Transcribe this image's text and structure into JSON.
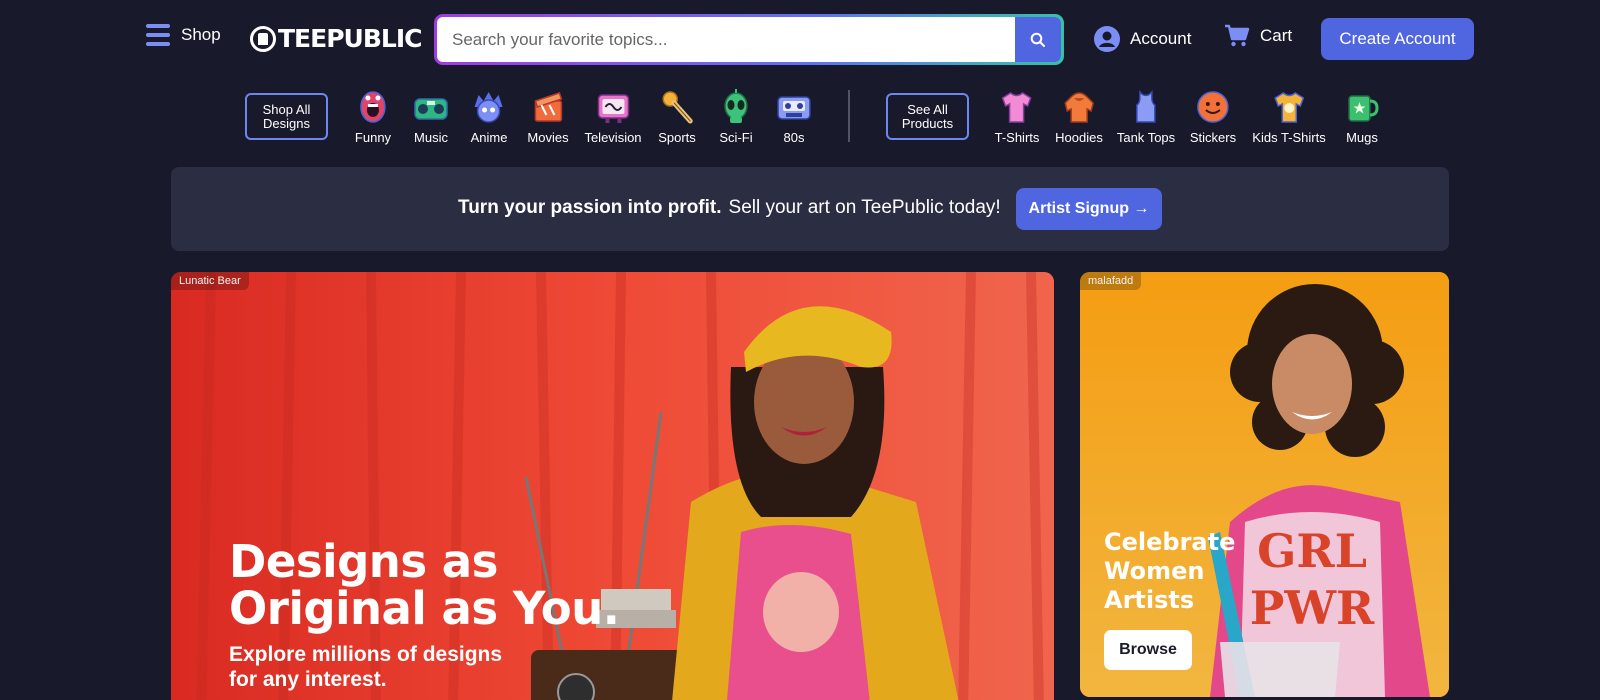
{
  "header": {
    "menu_label": "Shop",
    "logo_text": "TEEPUBLIC",
    "search_placeholder": "Search your favorite topics...",
    "account_label": "Account",
    "cart_label": "Cart",
    "create_account_label": "Create Account"
  },
  "nav": {
    "shop_all_label": "Shop All\nDesigns",
    "see_all_label": "See All\nProducts",
    "design_categories": [
      {
        "label": "Funny",
        "icon": "funny-icon"
      },
      {
        "label": "Music",
        "icon": "music-icon"
      },
      {
        "label": "Anime",
        "icon": "anime-icon"
      },
      {
        "label": "Movies",
        "icon": "movies-icon"
      },
      {
        "label": "Television",
        "icon": "television-icon"
      },
      {
        "label": "Sports",
        "icon": "sports-icon"
      },
      {
        "label": "Sci-Fi",
        "icon": "sci-fi-icon"
      },
      {
        "label": "80s",
        "icon": "80s-icon"
      }
    ],
    "product_categories": [
      {
        "label": "T-Shirts",
        "icon": "t-shirt-icon"
      },
      {
        "label": "Hoodies",
        "icon": "hoodie-icon"
      },
      {
        "label": "Tank Tops",
        "icon": "tank-top-icon"
      },
      {
        "label": "Stickers",
        "icon": "sticker-icon"
      },
      {
        "label": "Kids T-Shirts",
        "icon": "kids-t-shirt-icon"
      },
      {
        "label": "Mugs",
        "icon": "mug-icon"
      }
    ]
  },
  "banner": {
    "bold_text": "Turn your passion into profit.",
    "regular_text": "Sell your art on TeePublic today!",
    "button_label": "Artist Signup →"
  },
  "hero_main": {
    "credit": "Lunatic Bear",
    "title": "Designs as\nOriginal as You.",
    "subtitle": "Explore millions of designs\nfor any interest."
  },
  "hero_side": {
    "credit": "malafadd",
    "title": "Celebrate\nWomen\nArtists",
    "button_label": "Browse"
  },
  "colors": {
    "background": "#181a2b",
    "accent": "#4f66e0",
    "banner_bg": "#2b2e42",
    "hero_main_bg": "#e8382c",
    "hero_side_bg": "#f2a313"
  }
}
